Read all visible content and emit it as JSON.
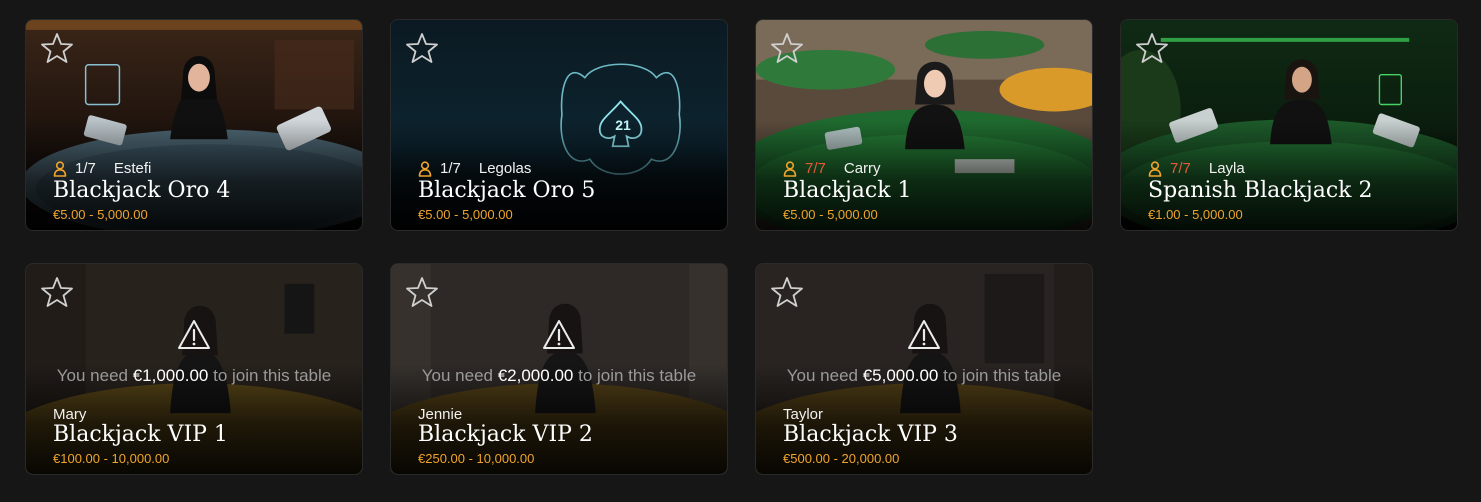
{
  "colors": {
    "background": "#161616",
    "limits": "#f0a42c",
    "seats_full": "#e8573a",
    "text": "#ffffff",
    "muted": "#9a9a9a"
  },
  "tables": [
    {
      "dealer": "Estefi",
      "seats": "1/7",
      "full": false,
      "name": "Blackjack Oro 4",
      "limits": "€5.00 - 5,000.00",
      "icon": "star-outline-icon"
    },
    {
      "dealer": "Legolas",
      "seats": "1/7",
      "full": false,
      "name": "Blackjack Oro 5",
      "limits": "€5.00 - 5,000.00",
      "icon": "star-outline-icon",
      "badge": "21"
    },
    {
      "dealer": "Carry",
      "seats": "7/7",
      "full": true,
      "name": "Blackjack 1",
      "limits": "€5.00 - 5,000.00",
      "icon": "star-outline-icon"
    },
    {
      "dealer": "Layla",
      "seats": "7/7",
      "full": true,
      "name": "Spanish Blackjack 2",
      "limits": "€1.00 - 5,000.00",
      "icon": "star-outline-icon"
    }
  ],
  "locked_tables": [
    {
      "dealer": "Mary",
      "name": "Blackjack VIP 1",
      "limits": "€100.00 - 10,000.00",
      "need_prefix": "You need",
      "need_amount": "€1,000.00",
      "need_suffix": "to join this table"
    },
    {
      "dealer": "Jennie",
      "name": "Blackjack VIP 2",
      "limits": "€250.00 - 10,000.00",
      "need_prefix": "You need",
      "need_amount": "€2,000.00",
      "need_suffix": "to join this table"
    },
    {
      "dealer": "Taylor",
      "name": "Blackjack VIP 3",
      "limits": "€500.00 - 20,000.00",
      "need_prefix": "You need",
      "need_amount": "€5,000.00",
      "need_suffix": "to join this table"
    }
  ]
}
